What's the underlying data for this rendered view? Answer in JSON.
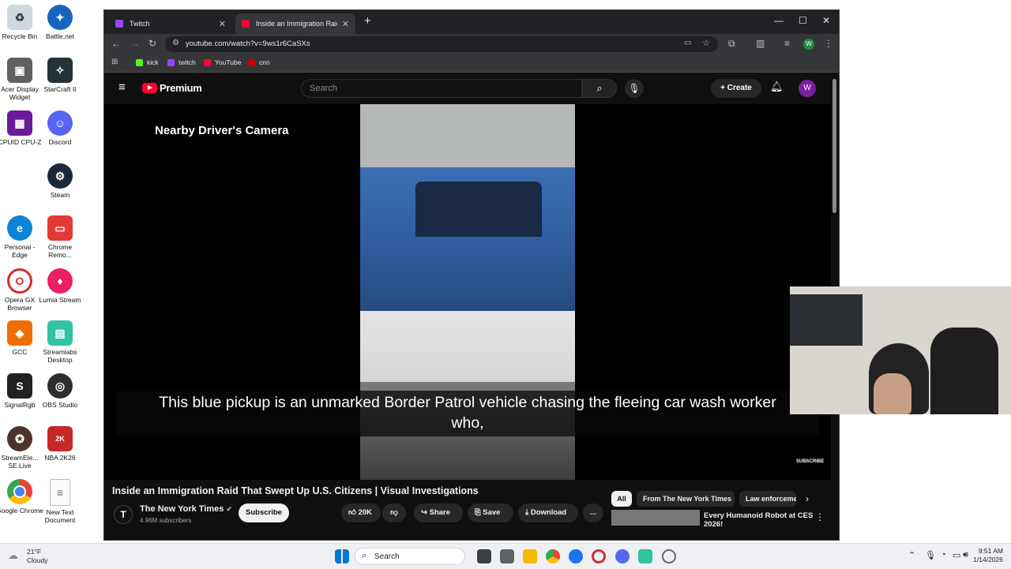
{
  "desktop": {
    "icons": [
      {
        "label": "Recycle Bin",
        "color": "#cfd8dc"
      },
      {
        "label": "Battle.net",
        "color": "#1565c0"
      },
      {
        "label": "Acer Display Widget",
        "color": "#616161"
      },
      {
        "label": "StarCraft II",
        "color": "#263238"
      },
      {
        "label": "CPUID CPU-Z",
        "color": "#6a1b9a"
      },
      {
        "label": "Discord",
        "color": "#5865f2"
      },
      {
        "label": "Steam",
        "color": "#1b2838"
      },
      {
        "label": "Personal - Edge",
        "color": "#0a84d6"
      },
      {
        "label": "Chrome Remo...",
        "color": "#e53935"
      },
      {
        "label": "Opera GX Browser",
        "color": "#d32f2f"
      },
      {
        "label": "Lumia Stream",
        "color": "#e91e63"
      },
      {
        "label": "GCC",
        "color": "#ef6c00"
      },
      {
        "label": "Streamlabs Desktop",
        "color": "#31c3a2"
      },
      {
        "label": "SignalRgb",
        "color": "#212121"
      },
      {
        "label": "OBS Studio",
        "color": "#302e31"
      },
      {
        "label": "StreamEle... SE.Live",
        "color": "#4e342e"
      },
      {
        "label": "NBA 2K26",
        "color": "#c62828"
      },
      {
        "label": "Google Chrome",
        "color": "#4caf50"
      },
      {
        "label": "New Text Document",
        "color": "#eeeeee"
      }
    ]
  },
  "browser": {
    "tabs": [
      {
        "title": "Twitch",
        "favicon_color": "#9146ff"
      },
      {
        "title": "Inside an Immigration Raid That",
        "favicon_color": "#ff0033"
      }
    ],
    "new_tab_icon": "+",
    "url": "youtube.com/watch?v=9ws1r6CaSXs",
    "bookmarks": [
      {
        "label": "kick",
        "color": "#53fc18"
      },
      {
        "label": "twitch",
        "color": "#9146ff"
      },
      {
        "label": "YouTube",
        "color": "#ff0033"
      },
      {
        "label": "cnn",
        "color": "#cc0000"
      }
    ],
    "profile_initial": "W"
  },
  "youtube": {
    "logo_text": "Premium",
    "search_placeholder": "Search",
    "create_label": "Create",
    "avatar_initial": "W",
    "video": {
      "overlay_label": "Nearby Driver's Camera",
      "caption_line1": "This blue pickup is an unmarked Border Patrol vehicle chasing the fleeing car wash worker",
      "caption_line2": "who,",
      "watermark": "SUBSCRIBE"
    },
    "title": "Inside an Immigration Raid That Swept Up U.S. Citizens | Visual Investigations",
    "channel": {
      "logo": "T",
      "name": "The New York Times",
      "subscribers": "4.96M subscribers",
      "subscribe_label": "Subscribe"
    },
    "actions": {
      "likes": "20K",
      "share": "Share",
      "save": "Save",
      "download": "Download",
      "more": "..."
    },
    "chips": [
      "All",
      "From The New York Times",
      "Law enforcement"
    ],
    "recommendation": {
      "title": "Every Humanoid Robot at CES 2026!"
    }
  },
  "taskbar": {
    "weather_temp": "21°F",
    "weather_desc": "Cloudy",
    "search_label": "Search",
    "time": "9:51 AM",
    "date": "1/14/2026"
  }
}
